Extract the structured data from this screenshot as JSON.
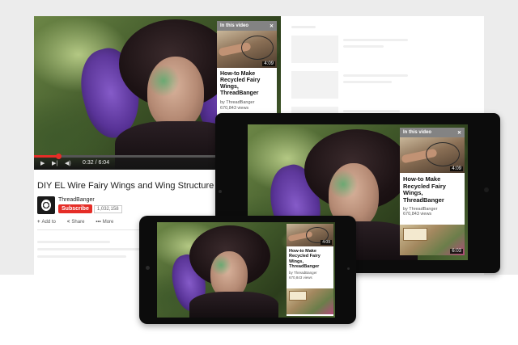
{
  "desktop": {
    "video_title": "DIY EL Wire Fairy Wings and Wing Structure Tutorial",
    "channel_name": "ThreadBanger",
    "subscribe_label": "Subscribe",
    "subscriber_count": "1,032,158",
    "time_current": "0:32",
    "time_total": "6:04",
    "actions": [
      {
        "icon": "+",
        "label": "Add to"
      },
      {
        "icon": "<",
        "label": "Share"
      },
      {
        "icon": "•••",
        "label": "More"
      }
    ]
  },
  "in_video_card": {
    "header": "In this video",
    "close_symbol": "✕",
    "card_title": "How-to Make Recycled Fairy Wings, ThreadBanger",
    "card_by": "by ThreadBanger",
    "card_views": "670,843 views",
    "card_duration": "4:09",
    "second_duration": "6:03"
  },
  "colors": {
    "accent_red": "#e52d27",
    "device_frame": "#0c0c0c"
  }
}
